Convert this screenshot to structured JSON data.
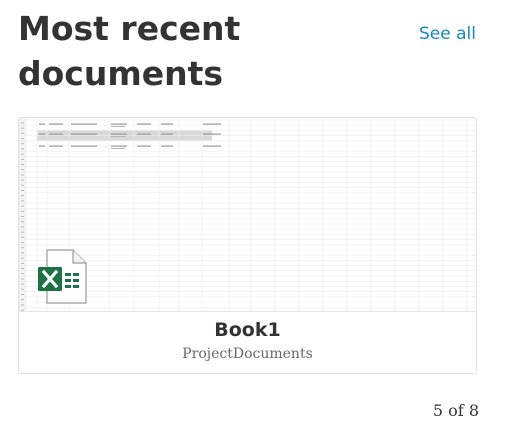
{
  "header": {
    "title": "Most recent documents",
    "see_all_label": "See all"
  },
  "document": {
    "name": "Book1",
    "location": "ProjectDocuments",
    "file_type_icon": "excel-icon",
    "thumbnail": "spreadsheet-preview"
  },
  "pagination": {
    "label": "5 of 8"
  },
  "colors": {
    "link": "#1a86c8",
    "excel_green": "#1e7145",
    "text": "#333333"
  }
}
